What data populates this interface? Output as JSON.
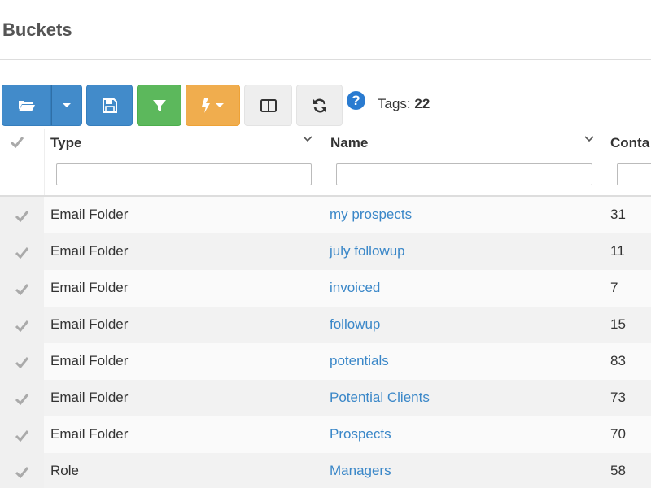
{
  "header": {
    "title": "Buckets"
  },
  "toolbar": {
    "buttons": [
      {
        "name": "open",
        "icon": "folder-open-icon"
      },
      {
        "name": "open-menu",
        "icon": "caret-down-icon"
      },
      {
        "name": "save",
        "icon": "save-icon"
      },
      {
        "name": "filter",
        "icon": "filter-icon"
      },
      {
        "name": "actions",
        "icon": "lightning-icon"
      },
      {
        "name": "columns",
        "icon": "columns-icon"
      },
      {
        "name": "refresh",
        "icon": "refresh-icon"
      }
    ],
    "help_icon": "question-circle-icon",
    "tags_label": "Tags:",
    "tags_count": "22"
  },
  "grid": {
    "columns": [
      {
        "key": "type",
        "label": "Type"
      },
      {
        "key": "name",
        "label": "Name"
      },
      {
        "key": "contacts",
        "label": "Conta"
      }
    ],
    "rows": [
      {
        "type": "Email Folder",
        "name": "my prospects",
        "contacts": "31"
      },
      {
        "type": "Email Folder",
        "name": "july followup",
        "contacts": "11"
      },
      {
        "type": "Email Folder",
        "name": "invoiced",
        "contacts": "7"
      },
      {
        "type": "Email Folder",
        "name": "followup",
        "contacts": "15"
      },
      {
        "type": "Email Folder",
        "name": "potentials",
        "contacts": "83"
      },
      {
        "type": "Email Folder",
        "name": "Potential Clients",
        "contacts": "73"
      },
      {
        "type": "Email Folder",
        "name": "Prospects",
        "contacts": "70"
      },
      {
        "type": "Role",
        "name": "Managers",
        "contacts": "58"
      }
    ]
  },
  "colors": {
    "primary": "#428bca",
    "success": "#5cb85c",
    "warning": "#f0ad4e",
    "link": "#3a87c8"
  }
}
